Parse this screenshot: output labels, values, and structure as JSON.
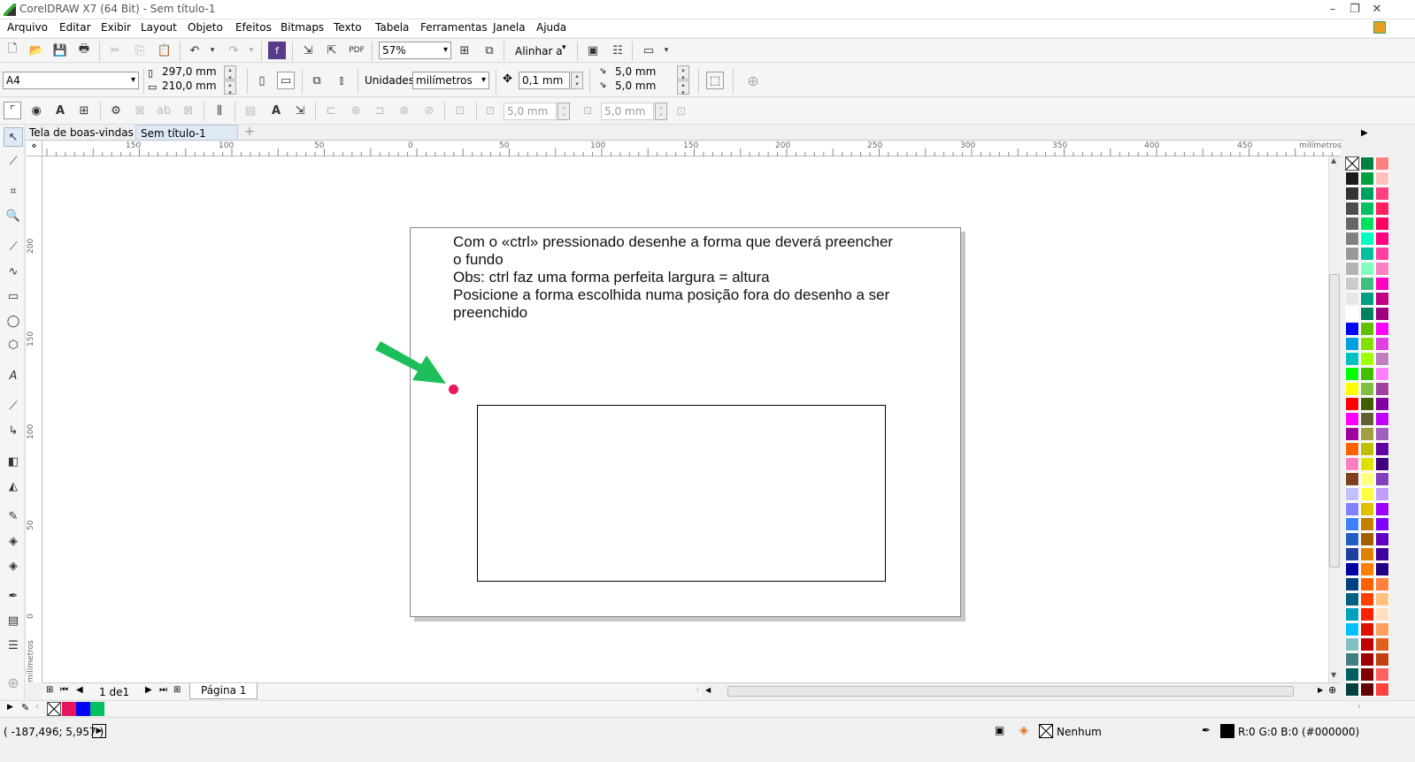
{
  "window": {
    "title": "CorelDRAW X7 (64 Bit) - Sem título-1"
  },
  "menu": [
    "Arquivo",
    "Editar",
    "Exibir",
    "Layout",
    "Objeto",
    "Efeitos",
    "Bitmaps",
    "Texto",
    "Tabela",
    "Ferramentas",
    "Janela",
    "Ajuda"
  ],
  "toolbar": {
    "zoom": "57%",
    "align_label": "Alinhar a"
  },
  "property_bar": {
    "page_size": "A4",
    "width": "297,0 mm",
    "height": "210,0 mm",
    "units_label": "Unidades:",
    "units": "milímetros",
    "nudge": "0,1 mm",
    "dup_x": "5,0 mm",
    "dup_y": "5,0 mm"
  },
  "toolbar3": {
    "field1": "5,0 mm",
    "field2": "5,0 mm"
  },
  "tabs": [
    "Tela de boas-vindas",
    "Sem título-1"
  ],
  "rulers": {
    "h_ticks": [
      "150",
      "100",
      "50",
      "0",
      "50",
      "100",
      "150",
      "200",
      "250",
      "300",
      "350",
      "400",
      "450"
    ],
    "h_unit": "milímetros",
    "v_ticks": [
      "200",
      "150",
      "100",
      "50",
      "0"
    ],
    "v_unit": "milímetros"
  },
  "document": {
    "text_lines": [
      "Com o «ctrl» pressionado desenhe a forma que deverá preencher",
      "o fundo",
      "Obs: ctrl faz uma forma perfeita largura = altura",
      "Posicione a forma escolhida numa posição fora do desenho a ser",
      "preenchido"
    ]
  },
  "page_nav": {
    "count": "1 de1",
    "page_tab": "Página 1"
  },
  "status": {
    "coords": "( -187,496; 5,957 )",
    "fill": "Nenhum",
    "outline": "R:0 G:0 B:0 (#000000)"
  },
  "colors": {
    "accent_arrow": "#1dbf5a",
    "dot": "#e8175d",
    "doc_palette": [
      "#e8175d",
      "#0000ff",
      "#00c060"
    ]
  }
}
